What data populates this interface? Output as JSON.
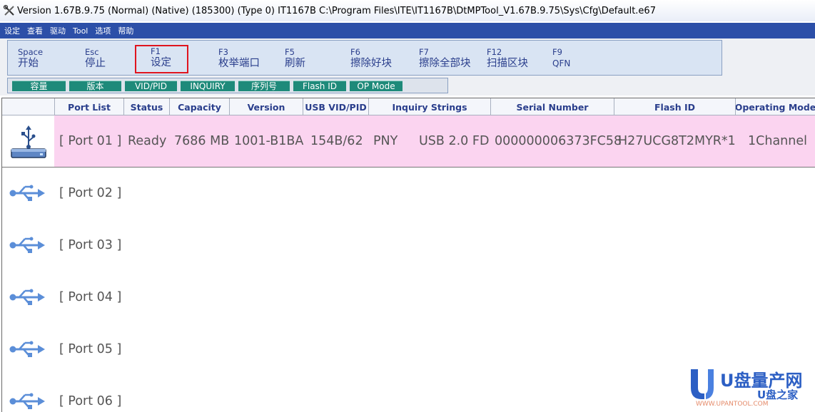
{
  "titlebar": {
    "title": "Version 1.67B.9.75 (Normal) (Native) (185300) (Type 0) IT1167B C:\\Program Files\\ITE\\IT1167B\\DtMPTool_V1.67B.9.75\\Sys\\Cfg\\Default.e67"
  },
  "menu": [
    "设定",
    "查看",
    "驱动",
    "Tool",
    "选项",
    "帮助"
  ],
  "toolbar": [
    {
      "key": "Space",
      "label": "开始"
    },
    {
      "key": "Esc",
      "label": "停止"
    },
    {
      "key": "F1",
      "label": "设定",
      "highlighted": true
    },
    {
      "key": "F3",
      "label": "枚举端口"
    },
    {
      "key": "F5",
      "label": "刷新"
    },
    {
      "key": "F6",
      "label": "擦除好块"
    },
    {
      "key": "F7",
      "label": "擦除全部块"
    },
    {
      "key": "F12",
      "label": "扫描区块"
    },
    {
      "key": "F9",
      "label": "QFN"
    }
  ],
  "tabs": [
    "容量",
    "版本",
    "VID/PID",
    "INQUIRY",
    "序列号",
    "Flash ID",
    "OP Mode"
  ],
  "columns": [
    "Port List",
    "Status",
    "Capacity",
    "Version",
    "USB VID/PID",
    "Inquiry Strings",
    "Serial Number",
    "Flash ID",
    "Operating Mode"
  ],
  "ports": [
    {
      "port": "[ Port 01 ]",
      "status": "Ready",
      "capacity": "7686 MB",
      "version": "1001-B1BA",
      "vidpid": "154B/62",
      "vendor": "PNY",
      "product": "USB 2.0 FD",
      "serial": "000000006373FC58",
      "flash_id": "H27UCG8T2MYR*1",
      "mode": "1Channel",
      "icon": "usb-drive-icon"
    },
    {
      "port": "[ Port 02 ]",
      "icon": "usb-icon"
    },
    {
      "port": "[ Port 03 ]",
      "icon": "usb-icon"
    },
    {
      "port": "[ Port 04 ]",
      "icon": "usb-icon"
    },
    {
      "port": "[ Port 05 ]",
      "icon": "usb-icon"
    },
    {
      "port": "[ Port 06 ]",
      "icon": "usb-icon"
    }
  ],
  "watermark": {
    "logo_text": "U盘量产网",
    "sub_text": "U盘之家",
    "url_text": "WWW.UPANTOOL.COM"
  },
  "colors": {
    "menubar": "#2c4fa8",
    "tab": "#1e8a7a",
    "active_row": "#fbd4f0",
    "highlight_border": "#e0141e",
    "toolbar_text": "#2a3e8c"
  }
}
